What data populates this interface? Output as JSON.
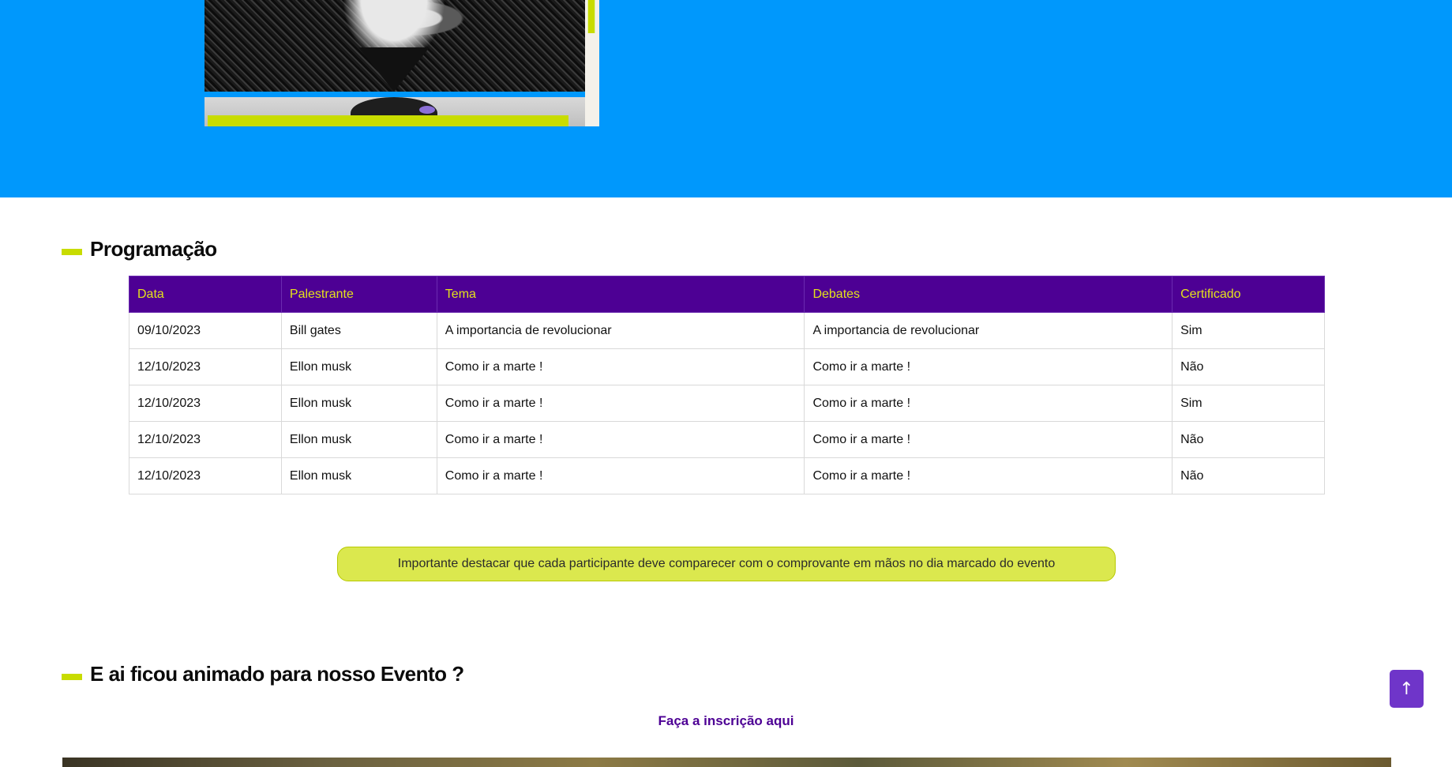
{
  "section_schedule": {
    "title": "Programação"
  },
  "schedule_table": {
    "headers": [
      "Data",
      "Palestrante",
      "Tema",
      "Debates",
      "Certificado"
    ],
    "rows": [
      [
        "09/10/2023",
        "Bill gates",
        "A importancia de revolucionar",
        "A importancia de revolucionar",
        "Sim"
      ],
      [
        "12/10/2023",
        "Ellon musk",
        "Como ir a marte !",
        "Como ir a marte !",
        "Não"
      ],
      [
        "12/10/2023",
        "Ellon musk",
        "Como ir a marte !",
        "Como ir a marte !",
        "Sim"
      ],
      [
        "12/10/2023",
        "Ellon musk",
        "Como ir a marte !",
        "Como ir a marte !",
        "Não"
      ],
      [
        "12/10/2023",
        "Ellon musk",
        "Como ir a marte !",
        "Como ir a marte !",
        "Não"
      ]
    ]
  },
  "notice": {
    "text": "Importante destacar que cada participante deve comparecer com o comprovante em mãos no dia marcado do evento"
  },
  "section_cta": {
    "title": "E ai ficou animado para nosso Evento ?"
  },
  "cta": {
    "link_label": "Faça a inscrição aqui"
  },
  "back_to_top": {
    "icon": "arrow-up-icon",
    "glyph": "↑"
  },
  "colors": {
    "hero_bg": "#0098fc",
    "accent_lime": "#c8dc00",
    "table_header_bg": "#4d0094",
    "table_header_text": "#e3e21b",
    "button_purple": "#6f35c9"
  }
}
